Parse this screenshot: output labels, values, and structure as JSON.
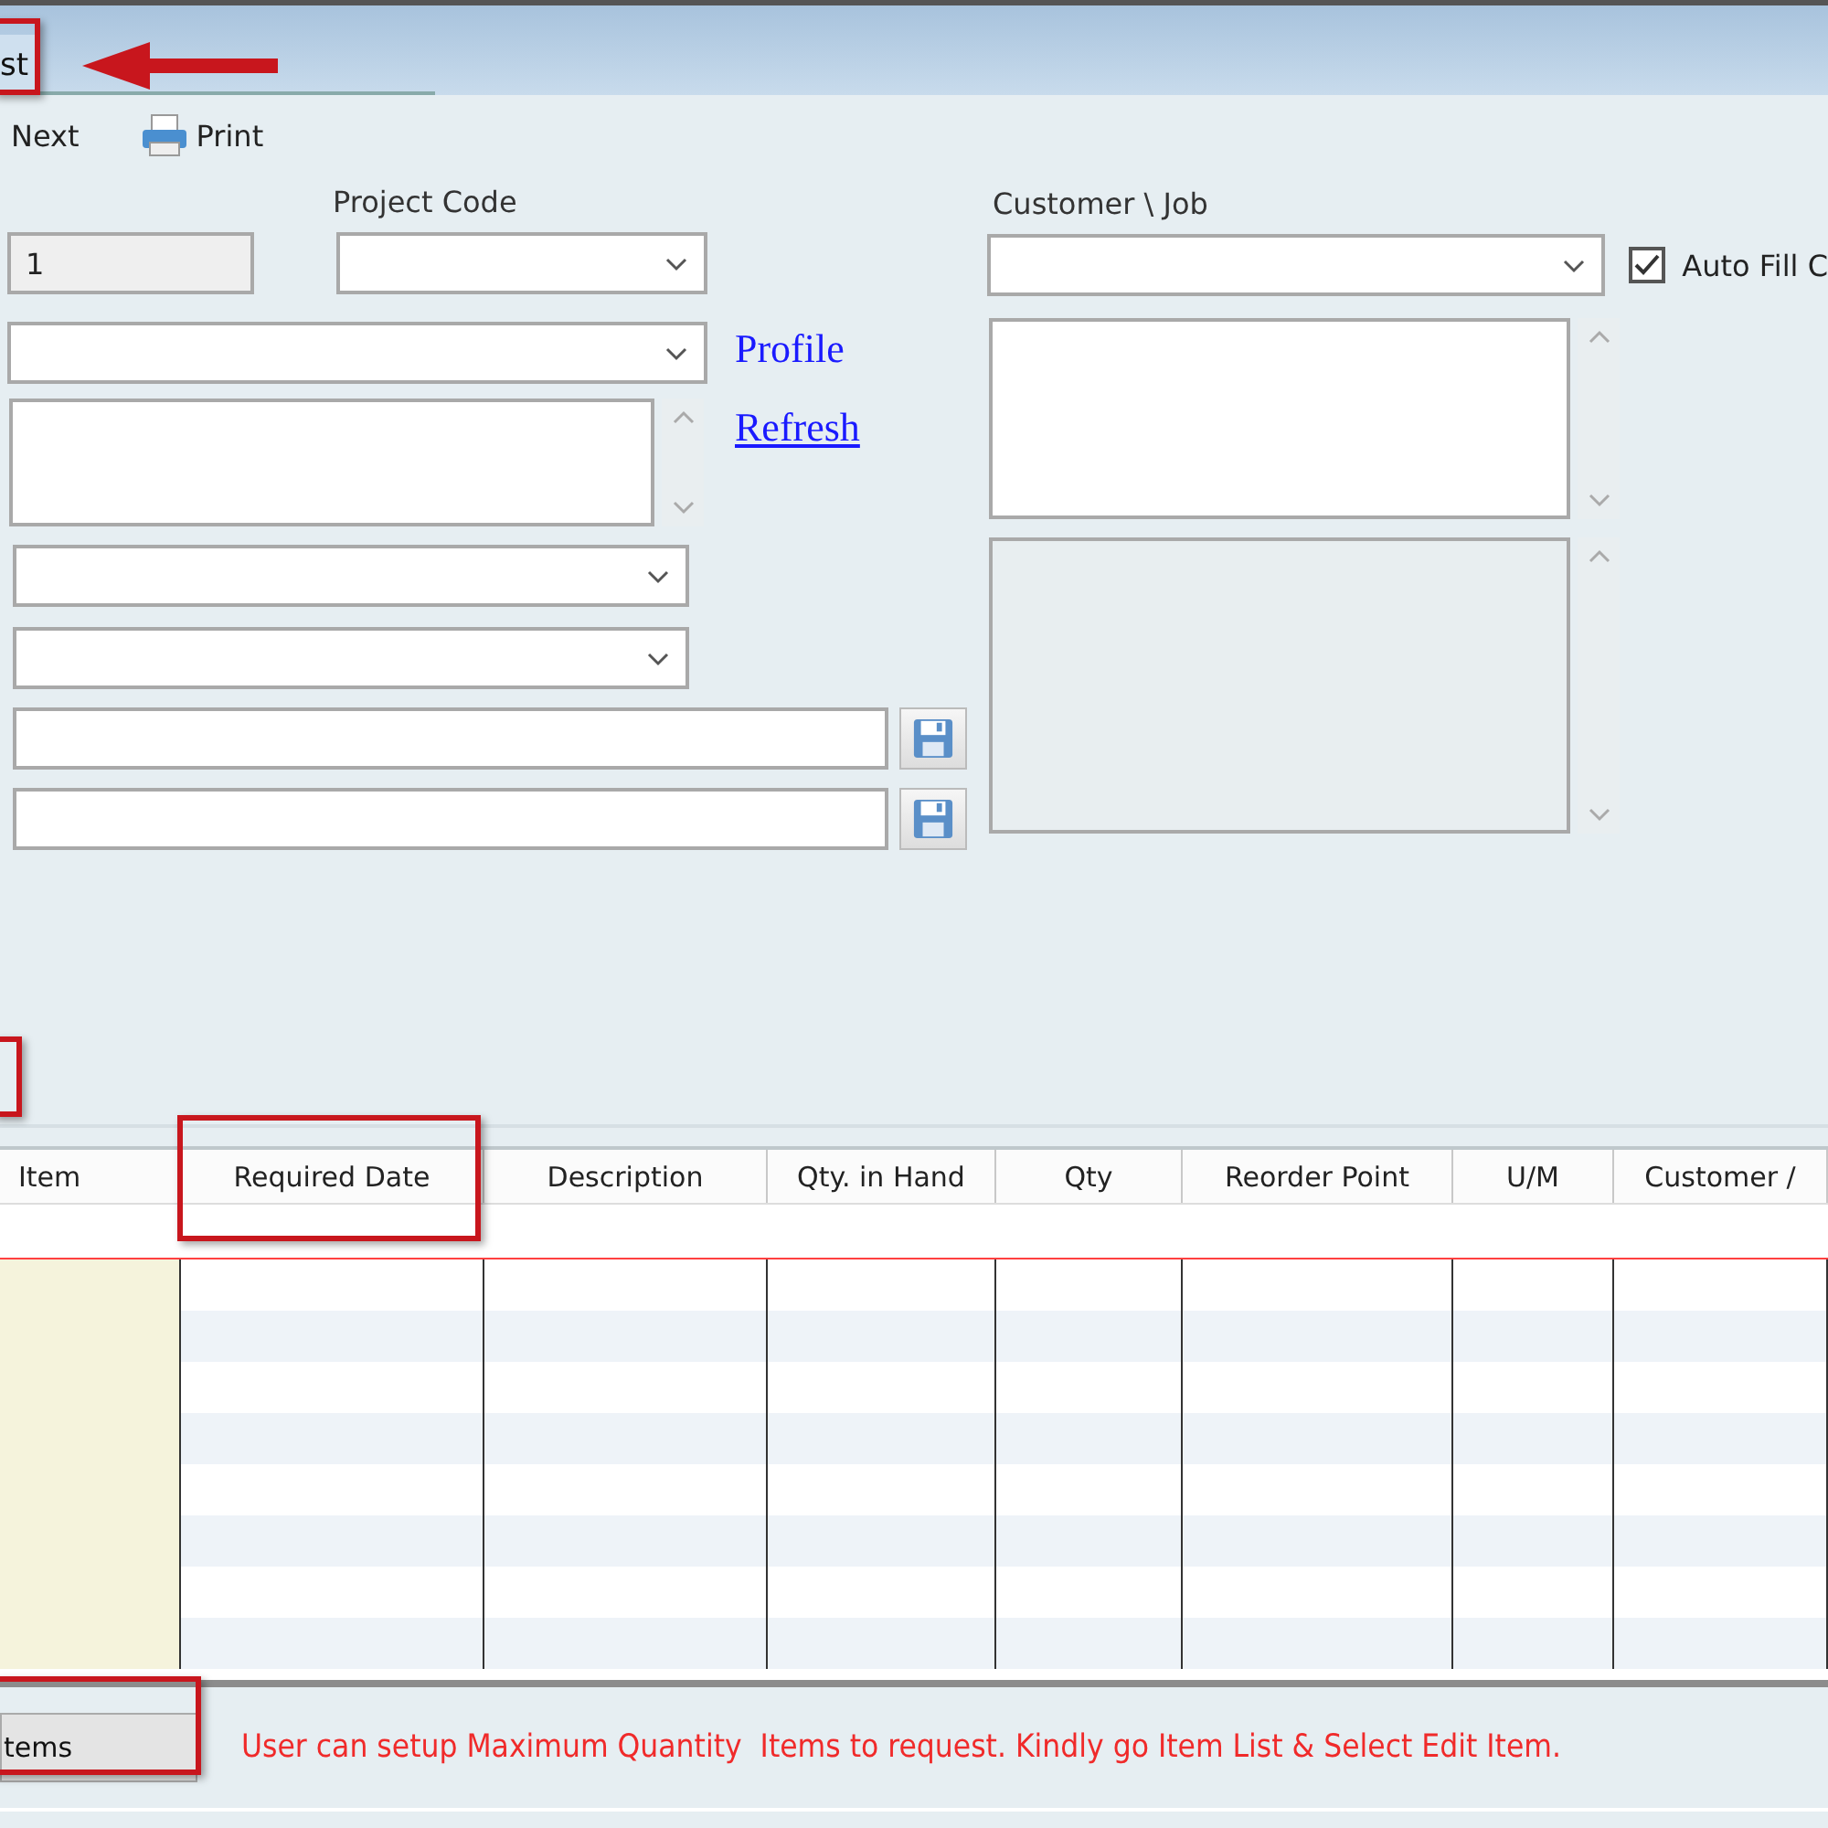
{
  "tabs": [
    {
      "label": "st",
      "selected": true
    }
  ],
  "toolbar": [
    {
      "kind": "next",
      "label": "Next"
    },
    {
      "kind": "print",
      "label": "Print"
    }
  ],
  "form": {
    "number_field": {
      "value": "1"
    },
    "project_code": {
      "label": "Project Code"
    },
    "links": [
      "Profile",
      "Refresh"
    ],
    "customer_job": {
      "label": "Customer \\ Job"
    },
    "auto_fill": {
      "label": "Auto Fill C",
      "checked": true
    }
  },
  "grid": {
    "columns": [
      "Item",
      "Required Date",
      "Description",
      "Qty. in Hand",
      "Qty",
      "Reorder Point",
      "U/M",
      "Customer /"
    ]
  },
  "footer": {
    "button": "tems",
    "message": "User can setup Maximum Quantity  Items to request. Kindly go Item List & Select Edit Item."
  }
}
